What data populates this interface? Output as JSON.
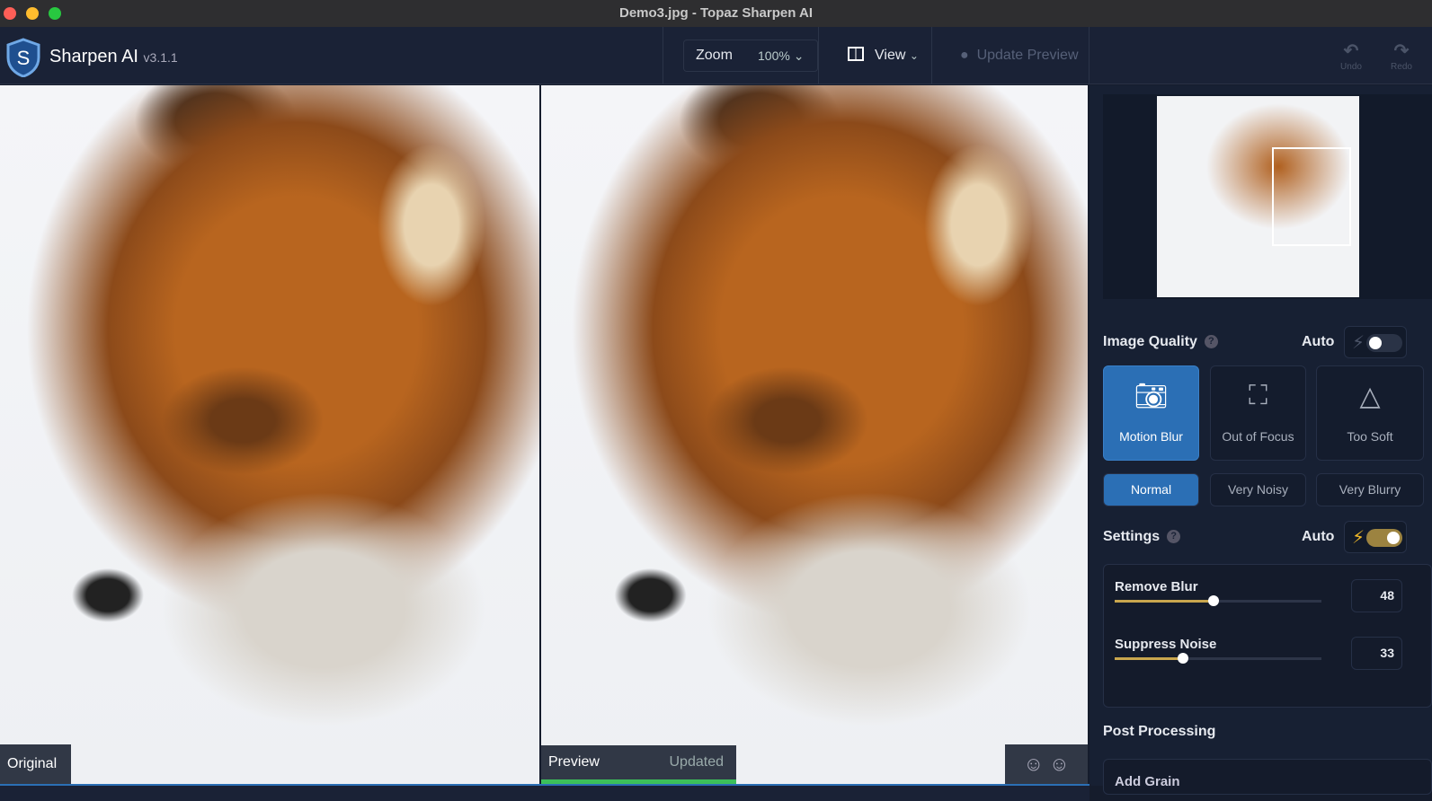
{
  "window": {
    "title": "Demo3.jpg - Topaz Sharpen AI"
  },
  "app": {
    "name": "Sharpen AI",
    "version": "v3.1.1"
  },
  "toolbar": {
    "zoom_label": "Zoom",
    "zoom_value": "100%",
    "view_label": "View",
    "update_preview": "Update Preview",
    "undo": "Undo",
    "redo": "Redo"
  },
  "images": {
    "original_label": "Original",
    "preview_label": "Preview",
    "preview_status": "Updated"
  },
  "panel": {
    "image_quality": {
      "title": "Image Quality",
      "auto": "Auto",
      "auto_on": false,
      "modes": [
        {
          "label": "Motion Blur",
          "selected": true
        },
        {
          "label": "Out of Focus",
          "selected": false
        },
        {
          "label": "Too Soft",
          "selected": false
        }
      ],
      "levels": [
        {
          "label": "Normal",
          "selected": true
        },
        {
          "label": "Very Noisy",
          "selected": false
        },
        {
          "label": "Very Blurry",
          "selected": false
        }
      ]
    },
    "settings": {
      "title": "Settings",
      "auto": "Auto",
      "auto_on": true,
      "sliders": [
        {
          "label": "Remove Blur",
          "value": "48"
        },
        {
          "label": "Suppress Noise",
          "value": "33"
        }
      ]
    },
    "post_processing": {
      "title": "Post Processing",
      "add_grain": "Add Grain"
    }
  },
  "colors": {
    "accent": "#2b6fb5",
    "slider": "#c9a64e"
  }
}
